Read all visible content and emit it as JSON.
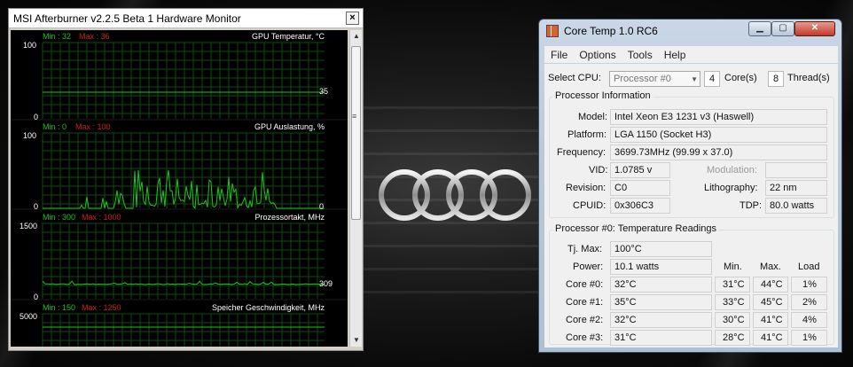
{
  "msi": {
    "title": "MSI Afterburner v2.2.5 Beta 1 Hardware Monitor",
    "close": "×",
    "graphs": [
      {
        "name": "GPU Temperatur, °C",
        "min_label": "Min : 32",
        "max_label": "Max : 36",
        "axis_top": "100",
        "axis_bottom": "0",
        "current": "35"
      },
      {
        "name": "GPU Auslastung, %",
        "min_label": "Min : 0",
        "max_label": "Max : 100",
        "axis_top": "100",
        "axis_bottom": "0",
        "current": "0"
      },
      {
        "name": "Prozessortakt, MHz",
        "min_label": "Min : 300",
        "max_label": "Max : 1000",
        "axis_top": "1500",
        "axis_bottom": "0",
        "current": "309"
      },
      {
        "name": "Speicher Geschwindigkeit, MHz",
        "min_label": "Min : 150",
        "max_label": "Max : 1250",
        "axis_top": "5000",
        "axis_bottom": "",
        "current": ""
      }
    ],
    "line_color": "#21c11f"
  },
  "coretemp": {
    "title": "Core Temp 1.0 RC6",
    "menu": [
      "File",
      "Options",
      "Tools",
      "Help"
    ],
    "select_cpu_label": "Select CPU:",
    "cpu_select": "Processor #0",
    "cores_value": "4",
    "cores_label": "Core(s)",
    "threads_value": "8",
    "threads_label": "Thread(s)",
    "info_title": "Processor Information",
    "model_label": "Model:",
    "model": "Intel Xeon E3 1231 v3 (Haswell)",
    "platform_label": "Platform:",
    "platform": "LGA 1150 (Socket H3)",
    "frequency_label": "Frequency:",
    "frequency": "3699.73MHz (99.99 x 37.0)",
    "vid_label": "VID:",
    "vid": "1.0785 v",
    "modulation_label": "Modulation:",
    "revision_label": "Revision:",
    "revision": "C0",
    "lithography_label": "Lithography:",
    "lithography": "22 nm",
    "cpuid_label": "CPUID:",
    "cpuid": "0x306C3",
    "tdp_label": "TDP:",
    "tdp": "80.0 watts",
    "temp_title": "Processor #0: Temperature Readings",
    "tjmax_label": "Tj. Max:",
    "tjmax": "100°C",
    "power_label": "Power:",
    "power": "10.1 watts",
    "col_min": "Min.",
    "col_max": "Max.",
    "col_load": "Load",
    "cores": [
      {
        "label": "Core #0:",
        "temp": "32°C",
        "min": "31°C",
        "max": "44°C",
        "load": "1%"
      },
      {
        "label": "Core #1:",
        "temp": "35°C",
        "min": "33°C",
        "max": "45°C",
        "load": "2%"
      },
      {
        "label": "Core #2:",
        "temp": "32°C",
        "min": "30°C",
        "max": "41°C",
        "load": "4%"
      },
      {
        "label": "Core #3:",
        "temp": "31°C",
        "min": "28°C",
        "max": "41°C",
        "load": "1%"
      }
    ]
  }
}
